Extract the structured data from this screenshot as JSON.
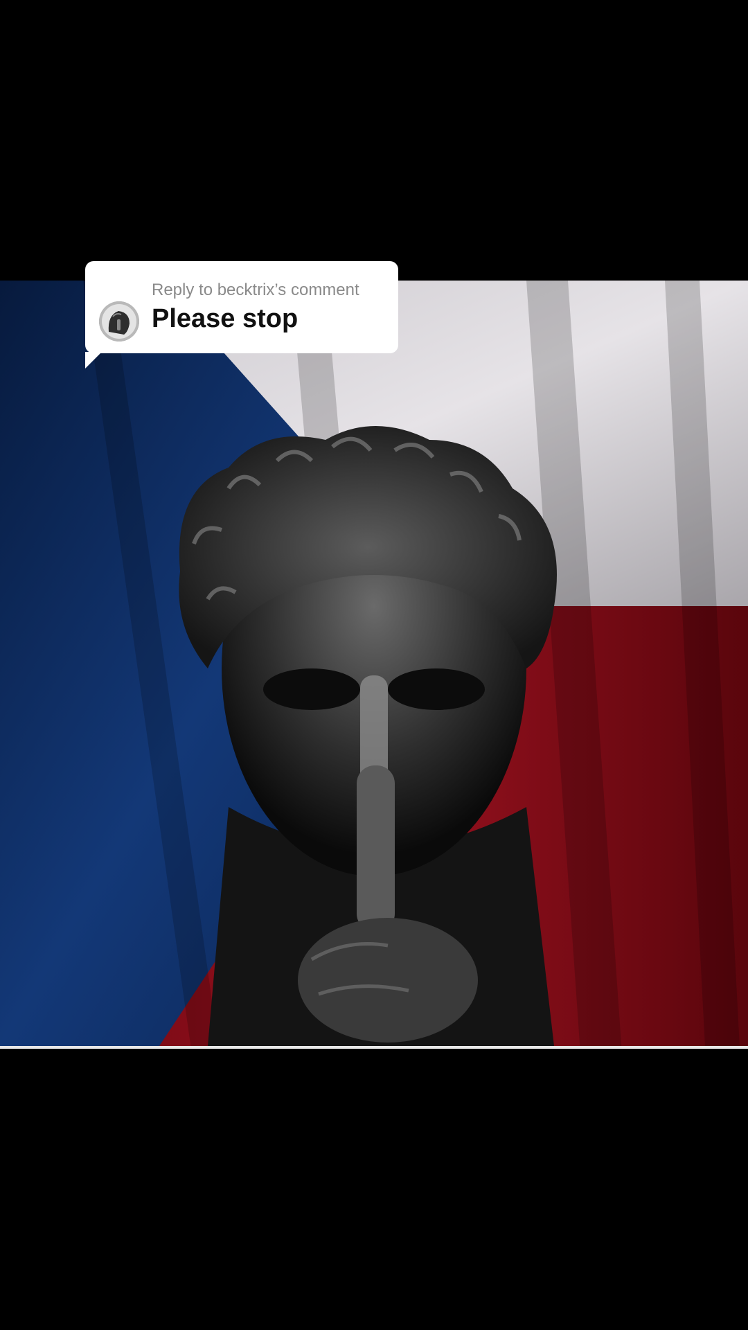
{
  "reply": {
    "label": "Reply to becktrix’s comment",
    "text": "Please stop",
    "avatar_icon": "statue-avatar-icon"
  },
  "video": {
    "content_icon": "statue-shushing-over-flag-image",
    "colors": {
      "flag_blue": "#0d2a5e",
      "flag_white": "#d9d6da",
      "flag_red": "#8b0d18",
      "statue": "#2a2a2a",
      "background": "#000000"
    }
  }
}
